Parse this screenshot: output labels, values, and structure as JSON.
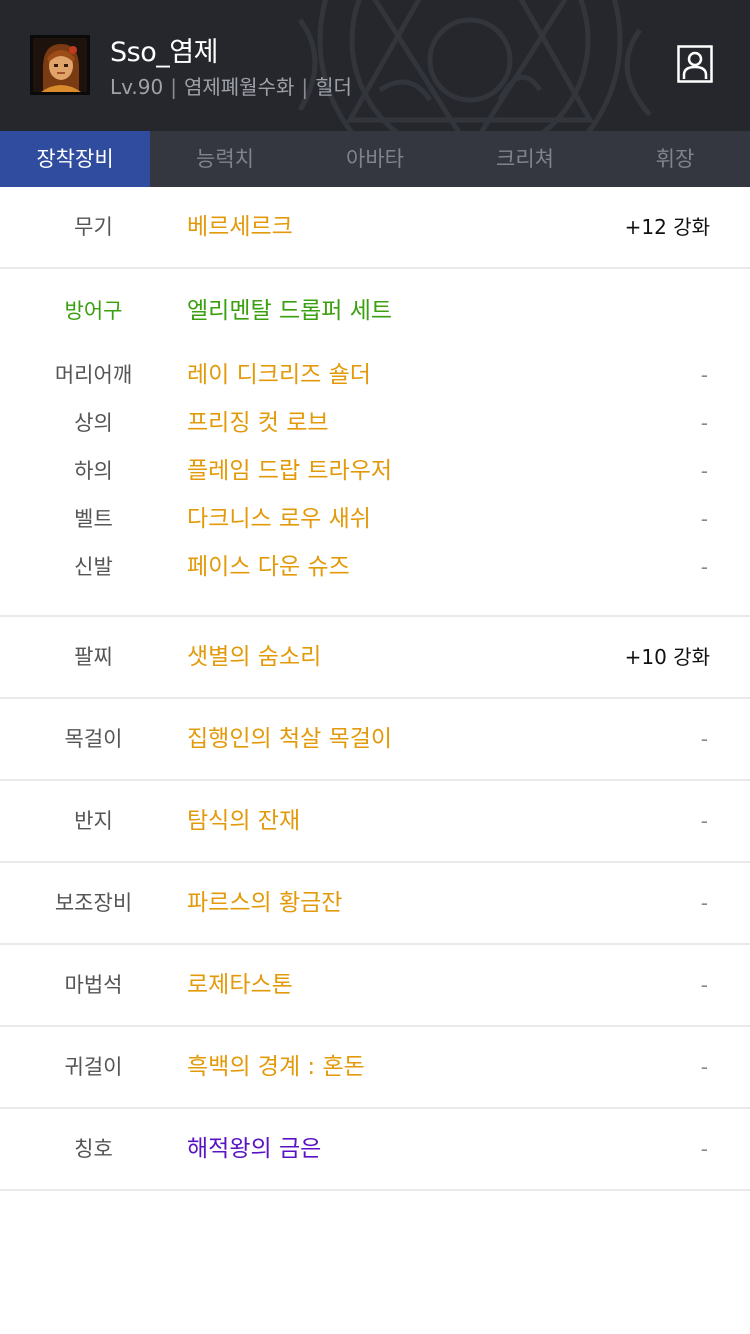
{
  "header": {
    "character_name": "Sso_염제",
    "level": "Lv.90",
    "adventure_group": "염제폐월수화",
    "job": "힐더",
    "separator": "|",
    "avatar_icon": "character-portrait-icon",
    "profile_icon": "user-profile-icon"
  },
  "tabs": [
    {
      "label": "장착장비",
      "active": true
    },
    {
      "label": "능력치",
      "active": false
    },
    {
      "label": "아바타",
      "active": false
    },
    {
      "label": "크리쳐",
      "active": false
    },
    {
      "label": "휘장",
      "active": false
    }
  ],
  "colors": {
    "item_gold": "#e39a0a",
    "set_green": "#3aa010",
    "title_purple": "#5a12c5",
    "tab_active": "#2f4c9f"
  },
  "equipment": {
    "weapon": {
      "slot": "무기",
      "name": "베르세르크",
      "enhance": "+12 강화"
    },
    "armor": {
      "slot": "방어구",
      "set_name": "엘리멘탈 드롭퍼 세트",
      "parts": [
        {
          "slot": "머리어깨",
          "name": "레이 디크리즈 숄더",
          "enhance": "-"
        },
        {
          "slot": "상의",
          "name": "프리징 컷 로브",
          "enhance": "-"
        },
        {
          "slot": "하의",
          "name": "플레임 드랍 트라우저",
          "enhance": "-"
        },
        {
          "slot": "벨트",
          "name": "다크니스 로우 새쉬",
          "enhance": "-"
        },
        {
          "slot": "신발",
          "name": "페이스 다운 슈즈",
          "enhance": "-"
        }
      ]
    },
    "bracelet": {
      "slot": "팔찌",
      "name": "샛별의 숨소리",
      "enhance": "+10 강화"
    },
    "necklace": {
      "slot": "목걸이",
      "name": "집행인의 척살 목걸이",
      "enhance": "-"
    },
    "ring": {
      "slot": "반지",
      "name": "탐식의 잔재",
      "enhance": "-"
    },
    "sub_equipment": {
      "slot": "보조장비",
      "name": "파르스의 황금잔",
      "enhance": "-"
    },
    "magic_stone": {
      "slot": "마법석",
      "name": "로제타스톤",
      "enhance": "-"
    },
    "earring": {
      "slot": "귀걸이",
      "name": "흑백의 경계 : 혼돈",
      "enhance": "-"
    },
    "title": {
      "slot": "칭호",
      "name": "해적왕의 금은",
      "enhance": "-"
    }
  }
}
